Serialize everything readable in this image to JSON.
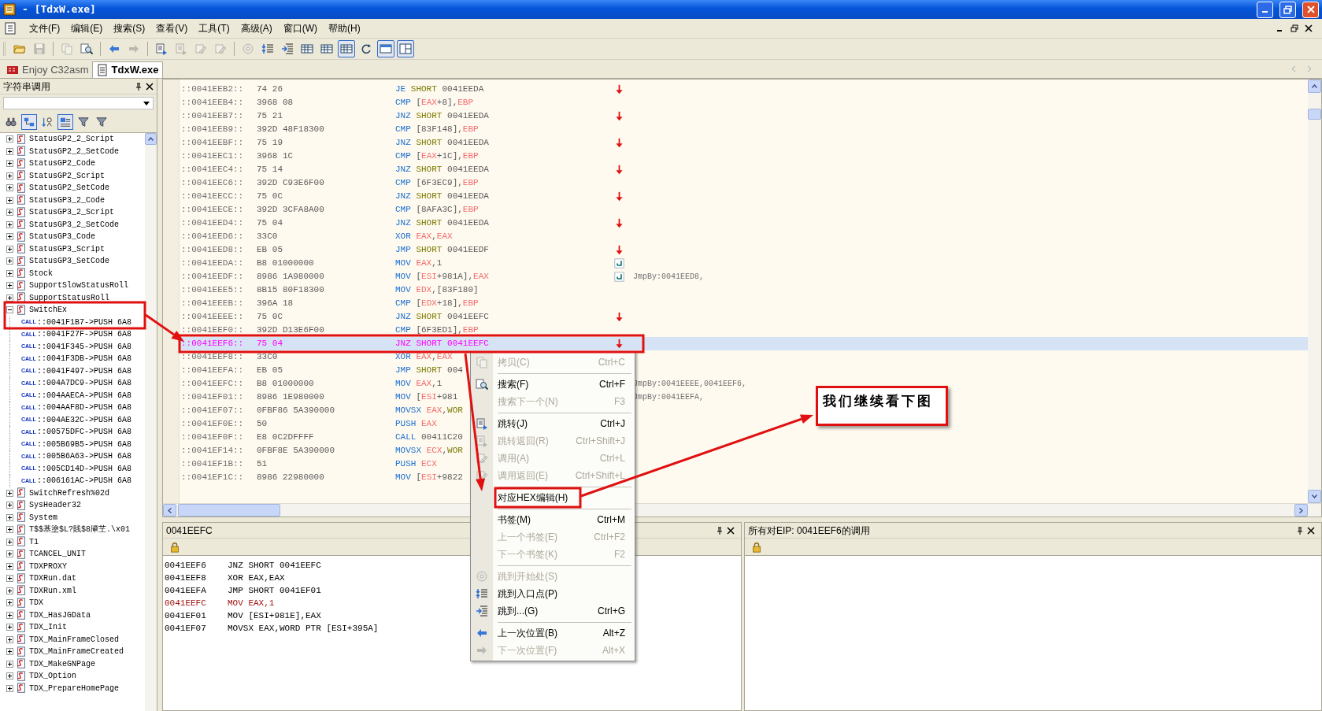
{
  "window": {
    "title": "- [TdxW.exe]"
  },
  "menu": [
    "文件(F)",
    "编辑(E)",
    "搜索(S)",
    "查看(V)",
    "工具(T)",
    "高级(A)",
    "窗口(W)",
    "帮助(H)"
  ],
  "toolbar": [
    [
      {
        "disabled": false,
        "pressed": false
      },
      {
        "disabled": true,
        "pressed": false
      }
    ],
    [
      {
        "disabled": true,
        "pressed": false
      },
      {
        "disabled": false,
        "pressed": false
      }
    ],
    [
      {
        "disabled": false,
        "pressed": false
      },
      {
        "disabled": true,
        "pressed": false
      }
    ],
    [
      {
        "disabled": false,
        "pressed": false
      },
      {
        "disabled": true,
        "pressed": false
      },
      {
        "disabled": true,
        "pressed": false
      },
      {
        "disabled": true,
        "pressed": false
      }
    ],
    [
      {
        "disabled": true,
        "pressed": false
      },
      {
        "disabled": false,
        "pressed": false
      },
      {
        "disabled": false,
        "pressed": false
      },
      {
        "disabled": false,
        "pressed": false
      },
      {
        "disabled": false,
        "pressed": false
      },
      {
        "disabled": false,
        "pressed": true
      },
      {
        "disabled": false,
        "pressed": false
      },
      {
        "disabled": false,
        "pressed": true
      },
      {
        "disabled": false,
        "pressed": true
      }
    ]
  ],
  "doc_tabs": [
    {
      "label": "Enjoy C32asm",
      "selected": false
    },
    {
      "label": "TdxW.exe",
      "selected": true
    }
  ],
  "string_panel": {
    "title": "字符串调用",
    "tools": [
      {
        "pressed": false
      },
      {
        "pressed": true
      },
      {
        "pressed": false
      },
      {
        "pressed": true
      },
      {
        "pressed": false
      },
      {
        "pressed": false
      }
    ],
    "items": [
      {
        "label": "StatusGP2_2_Script",
        "expanded": false
      },
      {
        "label": "StatusGP2_2_SetCode",
        "expanded": false
      },
      {
        "label": "StatusGP2_Code",
        "expanded": false
      },
      {
        "label": "StatusGP2_Script",
        "expanded": false
      },
      {
        "label": "StatusGP2_SetCode",
        "expanded": false
      },
      {
        "label": "StatusGP3_2_Code",
        "expanded": false
      },
      {
        "label": "StatusGP3_2_Script",
        "expanded": false
      },
      {
        "label": "StatusGP3_2_SetCode",
        "expanded": false
      },
      {
        "label": "StatusGP3_Code",
        "expanded": false
      },
      {
        "label": "StatusGP3_Script",
        "expanded": false
      },
      {
        "label": "StatusGP3_SetCode",
        "expanded": false
      },
      {
        "label": "Stock",
        "expanded": false
      },
      {
        "label": "SupportSlowStatusRoll",
        "expanded": false
      },
      {
        "label": "SupportStatusRoll",
        "expanded": false
      },
      {
        "label": "SwitchEx",
        "expanded": true,
        "children": [
          {
            "tag": "CALL",
            "label": "::0041F1B7->PUSH 6A8"
          },
          {
            "tag": "CALL",
            "label": "::0041F27F->PUSH 6A8"
          },
          {
            "tag": "CALL",
            "label": "::0041F345->PUSH 6A8"
          },
          {
            "tag": "CALL",
            "label": "::0041F3DB->PUSH 6A8"
          },
          {
            "tag": "CALL",
            "label": "::0041F497->PUSH 6A8"
          },
          {
            "tag": "CALL",
            "label": "::004A7DC9->PUSH 6A8"
          },
          {
            "tag": "CALL",
            "label": "::004AAECA->PUSH 6A8"
          },
          {
            "tag": "CALL",
            "label": "::004AAF8D->PUSH 6A8"
          },
          {
            "tag": "CALL",
            "label": "::004AE32C->PUSH 6A8"
          },
          {
            "tag": "CALL",
            "label": "::00575DFC->PUSH 6A8"
          },
          {
            "tag": "CALL",
            "label": "::005B69B5->PUSH 6A8"
          },
          {
            "tag": "CALL",
            "label": "::005B6A63->PUSH 6A8"
          },
          {
            "tag": "CALL",
            "label": "::005CD14D->PUSH 6A8"
          },
          {
            "tag": "CALL",
            "label": "::006161AC->PUSH 6A8"
          }
        ]
      },
      {
        "label": "SwitchRefresh%02d",
        "expanded": false
      },
      {
        "label": "SysHeader32",
        "expanded": false
      },
      {
        "label": "System",
        "expanded": false
      },
      {
        "label": "T$$基塗$L?賎$8厣芏.\\x01",
        "expanded": false
      },
      {
        "label": "T1",
        "expanded": false
      },
      {
        "label": "TCANCEL_UNIT",
        "expanded": false
      },
      {
        "label": "TDXPROXY",
        "expanded": false
      },
      {
        "label": "TDXRun.dat",
        "expanded": false
      },
      {
        "label": "TDXRun.xml",
        "expanded": false
      },
      {
        "label": "TDX",
        "expanded": false
      },
      {
        "label": "TDX_HasJGData",
        "expanded": false
      },
      {
        "label": "TDX_Init",
        "expanded": false
      },
      {
        "label": "TDX_MainFrameClosed",
        "expanded": false
      },
      {
        "label": "TDX_MainFrameCreated",
        "expanded": false
      },
      {
        "label": "TDX_MakeGNPage",
        "expanded": false
      },
      {
        "label": "TDX_Option",
        "expanded": false
      },
      {
        "label": "TDX_PrepareHomePage",
        "expanded": false
      }
    ]
  },
  "disasm": {
    "rows": [
      {
        "address": "::0041EEB2::",
        "bytes": "74 26",
        "mnemonic": "JE",
        "prefix": "SHORT",
        "operands": [
          {
            "kind": "plain",
            "text": "0041EEDA"
          }
        ],
        "jump_arrow": true,
        "jump_target": false,
        "selected": false
      },
      {
        "address": "::0041EEB4::",
        "bytes": "3968 08",
        "mnemonic": "CMP",
        "operands": [
          {
            "kind": "plain",
            "text": "["
          },
          {
            "kind": "reg",
            "text": "EAX"
          },
          {
            "kind": "plain",
            "text": "+8],"
          },
          {
            "kind": "reg",
            "text": "EBP"
          }
        ],
        "jump_arrow": false,
        "jump_target": false,
        "selected": false
      },
      {
        "address": "::0041EEB7::",
        "bytes": "75 21",
        "mnemonic": "JNZ",
        "prefix": "SHORT",
        "operands": [
          {
            "kind": "plain",
            "text": "0041EEDA"
          }
        ],
        "jump_arrow": true,
        "jump_target": false,
        "selected": false
      },
      {
        "address": "::0041EEB9::",
        "bytes": "392D 48F18300",
        "mnemonic": "CMP",
        "operands": [
          {
            "kind": "plain",
            "text": "[83F148],"
          },
          {
            "kind": "reg",
            "text": "EBP"
          }
        ],
        "jump_arrow": false,
        "jump_target": false,
        "selected": false
      },
      {
        "address": "::0041EEBF::",
        "bytes": "75 19",
        "mnemonic": "JNZ",
        "prefix": "SHORT",
        "operands": [
          {
            "kind": "plain",
            "text": "0041EEDA"
          }
        ],
        "jump_arrow": true,
        "jump_target": false,
        "selected": false
      },
      {
        "address": "::0041EEC1::",
        "bytes": "3968 1C",
        "mnemonic": "CMP",
        "operands": [
          {
            "kind": "plain",
            "text": "["
          },
          {
            "kind": "reg",
            "text": "EAX"
          },
          {
            "kind": "plain",
            "text": "+1C],"
          },
          {
            "kind": "reg",
            "text": "EBP"
          }
        ],
        "jump_arrow": false,
        "jump_target": false,
        "selected": false
      },
      {
        "address": "::0041EEC4::",
        "bytes": "75 14",
        "mnemonic": "JNZ",
        "prefix": "SHORT",
        "operands": [
          {
            "kind": "plain",
            "text": "0041EEDA"
          }
        ],
        "jump_arrow": true,
        "jump_target": false,
        "selected": false
      },
      {
        "address": "::0041EEC6::",
        "bytes": "392D C93E6F00",
        "mnemonic": "CMP",
        "operands": [
          {
            "kind": "plain",
            "text": "[6F3EC9],"
          },
          {
            "kind": "reg",
            "text": "EBP"
          }
        ],
        "jump_arrow": false,
        "jump_target": false,
        "selected": false
      },
      {
        "address": "::0041EECC::",
        "bytes": "75 0C",
        "mnemonic": "JNZ",
        "prefix": "SHORT",
        "operands": [
          {
            "kind": "plain",
            "text": "0041EEDA"
          }
        ],
        "jump_arrow": true,
        "jump_target": false,
        "selected": false
      },
      {
        "address": "::0041EECE::",
        "bytes": "392D 3CFA8A00",
        "mnemonic": "CMP",
        "operands": [
          {
            "kind": "plain",
            "text": "[8AFA3C],"
          },
          {
            "kind": "reg",
            "text": "EBP"
          }
        ],
        "jump_arrow": false,
        "jump_target": false,
        "selected": false
      },
      {
        "address": "::0041EED4::",
        "bytes": "75 04",
        "mnemonic": "JNZ",
        "prefix": "SHORT",
        "operands": [
          {
            "kind": "plain",
            "text": "0041EEDA"
          }
        ],
        "jump_arrow": true,
        "jump_target": false,
        "selected": false
      },
      {
        "address": "::0041EED6::",
        "bytes": "33C0",
        "mnemonic": "XOR",
        "operands": [
          {
            "kind": "reg",
            "text": "EAX"
          },
          {
            "kind": "plain",
            "text": ","
          },
          {
            "kind": "reg",
            "text": "EAX"
          }
        ],
        "jump_arrow": false,
        "jump_target": false,
        "selected": false
      },
      {
        "address": "::0041EED8::",
        "bytes": "EB 05",
        "mnemonic": "JMP",
        "prefix": "SHORT",
        "operands": [
          {
            "kind": "plain",
            "text": "0041EEDF"
          }
        ],
        "jump_arrow": true,
        "jump_target": false,
        "selected": false
      },
      {
        "address": "::0041EEDA::",
        "bytes": "B8 01000000",
        "mnemonic": "MOV",
        "operands": [
          {
            "kind": "reg",
            "text": "EAX"
          },
          {
            "kind": "plain",
            "text": ",1"
          }
        ],
        "jump_arrow": false,
        "jump_target": true,
        "selected": false
      },
      {
        "address": "::0041EEDF::",
        "bytes": "8986 1A980000",
        "mnemonic": "MOV",
        "operands": [
          {
            "kind": "plain",
            "text": "["
          },
          {
            "kind": "reg",
            "text": "ESI"
          },
          {
            "kind": "plain",
            "text": "+981A],"
          },
          {
            "kind": "reg",
            "text": "EAX"
          }
        ],
        "jump_arrow": false,
        "jump_target": true,
        "comment": "JmpBy:0041EED8,",
        "selected": false
      },
      {
        "address": "::0041EEE5::",
        "bytes": "8B15 80F18300",
        "mnemonic": "MOV",
        "operands": [
          {
            "kind": "reg",
            "text": "EDX"
          },
          {
            "kind": "plain",
            "text": ",[83F180]"
          }
        ],
        "jump_arrow": false,
        "jump_target": false,
        "selected": false
      },
      {
        "address": "::0041EEEB::",
        "bytes": "396A 18",
        "mnemonic": "CMP",
        "operands": [
          {
            "kind": "plain",
            "text": "["
          },
          {
            "kind": "reg",
            "text": "EDX"
          },
          {
            "kind": "plain",
            "text": "+18],"
          },
          {
            "kind": "reg",
            "text": "EBP"
          }
        ],
        "jump_arrow": false,
        "jump_target": false,
        "selected": false
      },
      {
        "address": "::0041EEEE::",
        "bytes": "75 0C",
        "mnemonic": "JNZ",
        "prefix": "SHORT",
        "operands": [
          {
            "kind": "plain",
            "text": "0041EEFC"
          }
        ],
        "jump_arrow": true,
        "jump_target": false,
        "selected": false
      },
      {
        "address": "::0041EEF0::",
        "bytes": "392D D13E6F00",
        "mnemonic": "CMP",
        "operands": [
          {
            "kind": "plain",
            "text": "[6F3ED1],"
          },
          {
            "kind": "reg",
            "text": "EBP"
          }
        ],
        "jump_arrow": false,
        "jump_target": false,
        "selected": false
      },
      {
        "address": "::0041EEF6::",
        "bytes": "75 04",
        "mnemonic": "JNZ",
        "prefix": "SHORT",
        "operands": [
          {
            "kind": "plain",
            "text": "0041EEFC"
          }
        ],
        "jump_arrow": true,
        "jump_target": false,
        "selected": true
      },
      {
        "address": "::0041EEF8::",
        "bytes": "33C0",
        "mnemonic": "XOR",
        "operands": [
          {
            "kind": "reg",
            "text": "EAX"
          },
          {
            "kind": "plain",
            "text": ","
          },
          {
            "kind": "reg",
            "text": "EAX"
          }
        ],
        "jump_arrow": false,
        "jump_target": false,
        "selected": false
      },
      {
        "address": "::0041EEFA::",
        "bytes": "EB 05",
        "mnemonic": "JMP",
        "prefix": "SHORT",
        "operands": [
          {
            "kind": "plain",
            "text": "004"
          }
        ],
        "jump_arrow": false,
        "jump_target": false,
        "selected": false
      },
      {
        "address": "::0041EEFC::",
        "bytes": "B8 01000000",
        "mnemonic": "MOV",
        "operands": [
          {
            "kind": "reg",
            "text": "EAX"
          },
          {
            "kind": "plain",
            "text": ",1"
          }
        ],
        "jump_arrow": false,
        "jump_target": false,
        "comment": "JmpBy:0041EEEE,0041EEF6,",
        "selected": false
      },
      {
        "address": "::0041EF01::",
        "bytes": "8986 1E980000",
        "mnemonic": "MOV",
        "operands": [
          {
            "kind": "plain",
            "text": "["
          },
          {
            "kind": "reg",
            "text": "ESI"
          },
          {
            "kind": "plain",
            "text": "+981"
          }
        ],
        "jump_arrow": false,
        "jump_target": false,
        "comment": "JmpBy:0041EEFA,",
        "selected": false
      },
      {
        "address": "::0041EF07::",
        "bytes": "0FBF86 5A390000",
        "mnemonic": "MOVSX",
        "operands": [
          {
            "kind": "reg",
            "text": "EAX"
          },
          {
            "kind": "plain",
            "text": ","
          },
          {
            "kind": "kw",
            "text": "WOR"
          }
        ],
        "jump_arrow": false,
        "jump_target": false,
        "selected": false
      },
      {
        "address": "::0041EF0E::",
        "bytes": "50",
        "mnemonic": "PUSH",
        "operands": [
          {
            "kind": "reg",
            "text": "EAX"
          }
        ],
        "jump_arrow": false,
        "jump_target": false,
        "selected": false
      },
      {
        "address": "::0041EF0F::",
        "bytes": "E8 0C2DFFFF",
        "mnemonic": "CALL",
        "operands": [
          {
            "kind": "plain",
            "text": "00411C20"
          }
        ],
        "jump_arrow": false,
        "jump_target": false,
        "selected": false
      },
      {
        "address": "::0041EF14::",
        "bytes": "0FBF8E 5A390000",
        "mnemonic": "MOVSX",
        "operands": [
          {
            "kind": "reg",
            "text": "ECX"
          },
          {
            "kind": "plain",
            "text": ","
          },
          {
            "kind": "kw",
            "text": "WOR"
          }
        ],
        "jump_arrow": false,
        "jump_target": false,
        "selected": false
      },
      {
        "address": "::0041EF1B::",
        "bytes": "51",
        "mnemonic": "PUSH",
        "operands": [
          {
            "kind": "reg",
            "text": "ECX"
          }
        ],
        "jump_arrow": false,
        "jump_target": false,
        "selected": false
      },
      {
        "address": "::0041EF1C::",
        "bytes": "8986 22980000",
        "mnemonic": "MOV",
        "operands": [
          {
            "kind": "plain",
            "text": "["
          },
          {
            "kind": "reg",
            "text": "ESI"
          },
          {
            "kind": "plain",
            "text": "+9822"
          }
        ],
        "jump_arrow": false,
        "jump_target": false,
        "selected": false
      }
    ]
  },
  "xref_panel": {
    "title": "0041EEFC",
    "lines": [
      {
        "address": "0041EEF6",
        "text": "JNZ SHORT 0041EEFC",
        "current": false
      },
      {
        "address": "0041EEF8",
        "text": "XOR EAX,EAX",
        "current": false
      },
      {
        "address": "0041EEFA",
        "text": "JMP SHORT 0041EF01",
        "current": false
      },
      {
        "address": "0041EEFC",
        "text": "MOV EAX,1",
        "current": true
      },
      {
        "address": "0041EF01",
        "text": "MOV [ESI+981E],EAX",
        "current": false
      },
      {
        "address": "0041EF07",
        "text": "MOVSX EAX,WORD PTR [ESI+395A]",
        "current": false
      }
    ]
  },
  "calls_panel": {
    "title": "所有对EIP: 0041EEF6的调用"
  },
  "context_menu": [
    [
      {
        "label": "拷贝(C)",
        "shortcut": "Ctrl+C",
        "disabled": true
      }
    ],
    [
      {
        "label": "搜索(F)",
        "shortcut": "Ctrl+F",
        "disabled": false
      },
      {
        "label": "搜索下一个(N)",
        "shortcut": "F3",
        "disabled": true
      }
    ],
    [
      {
        "label": "跳转(J)",
        "shortcut": "Ctrl+J",
        "disabled": false
      },
      {
        "label": "跳转返回(R)",
        "shortcut": "Ctrl+Shift+J",
        "disabled": true
      },
      {
        "label": "调用(A)",
        "shortcut": "Ctrl+L",
        "disabled": true
      },
      {
        "label": "调用返回(E)",
        "shortcut": "Ctrl+Shift+L",
        "disabled": true
      }
    ],
    [
      {
        "label": "对应HEX编辑(H)",
        "disabled": false
      }
    ],
    [
      {
        "label": "书签(M)",
        "shortcut": "Ctrl+M",
        "disabled": false
      },
      {
        "label": "上一个书签(E)",
        "shortcut": "Ctrl+F2",
        "disabled": true
      },
      {
        "label": "下一个书签(K)",
        "shortcut": "F2",
        "disabled": true
      }
    ],
    [
      {
        "label": "跳到开始处(S)",
        "disabled": true
      },
      {
        "label": "跳到入口点(P)",
        "disabled": false
      },
      {
        "label": "跳到...(G)",
        "shortcut": "Ctrl+G",
        "disabled": false
      }
    ],
    [
      {
        "label": "上一次位置(B)",
        "shortcut": "Alt+Z",
        "disabled": false
      },
      {
        "label": "下一次位置(F)",
        "shortcut": "Alt+X",
        "disabled": true
      }
    ]
  ],
  "annotation": {
    "callout": "我们继续看下图"
  }
}
